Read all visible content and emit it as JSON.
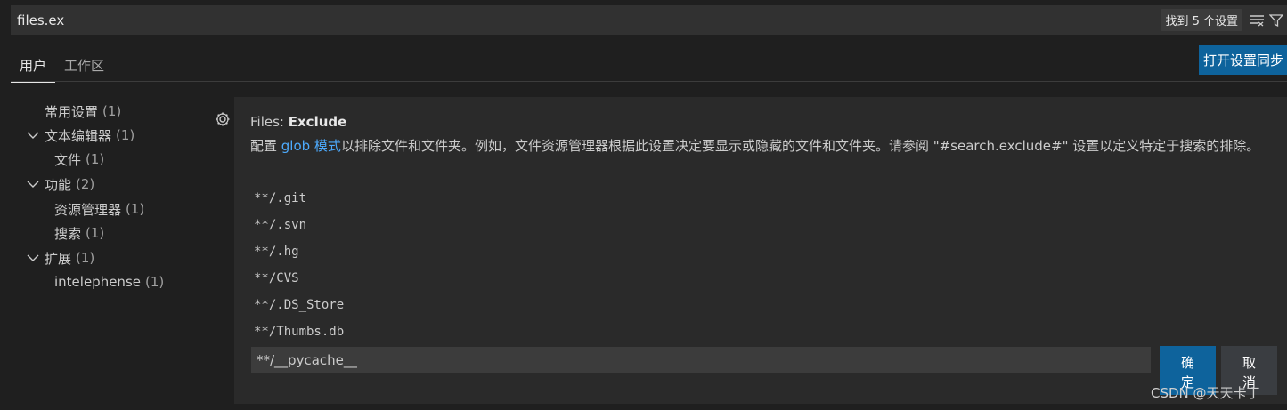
{
  "search": {
    "value": "files.ex",
    "result_count": "找到 5 个设置"
  },
  "tabs": [
    {
      "label": "用户"
    },
    {
      "label": "工作区"
    }
  ],
  "sync_button": "打开设置同步",
  "tree": [
    {
      "label": "常用设置",
      "count": "(1)",
      "expanded": null
    },
    {
      "label": "文本编辑器",
      "count": "(1)",
      "expanded": true
    },
    {
      "label": "文件",
      "count": "(1)",
      "expanded": null
    },
    {
      "label": "功能",
      "count": "(2)",
      "expanded": true
    },
    {
      "label": "资源管理器",
      "count": "(1)",
      "expanded": null
    },
    {
      "label": "搜索",
      "count": "(1)",
      "expanded": null
    },
    {
      "label": "扩展",
      "count": "(1)",
      "expanded": true
    },
    {
      "label": "intelephense",
      "count": "(1)",
      "expanded": null
    }
  ],
  "setting": {
    "title_prefix": "Files: ",
    "title_name": "Exclude",
    "desc_before": "配置 ",
    "desc_link": "glob 模式",
    "desc_after": "以排除文件和文件夹。例如，文件资源管理器根据此设置决定要显示或隐藏的文件和文件夹。请参阅 \"#search.exclude#\" 设置以定义特定于搜索的排除。",
    "patterns": [
      "**/.git",
      "**/.svn",
      "**/.hg",
      "**/CVS",
      "**/.DS_Store",
      "**/Thumbs.db"
    ],
    "edit_value": "**/__pycache__",
    "ok_label": "确定",
    "cancel_label": "取消"
  },
  "watermark": "CSDN @天天卡丁",
  "colors": {
    "accent": "#0e639c",
    "link": "#4daafc",
    "background": "#1f1f1f"
  }
}
